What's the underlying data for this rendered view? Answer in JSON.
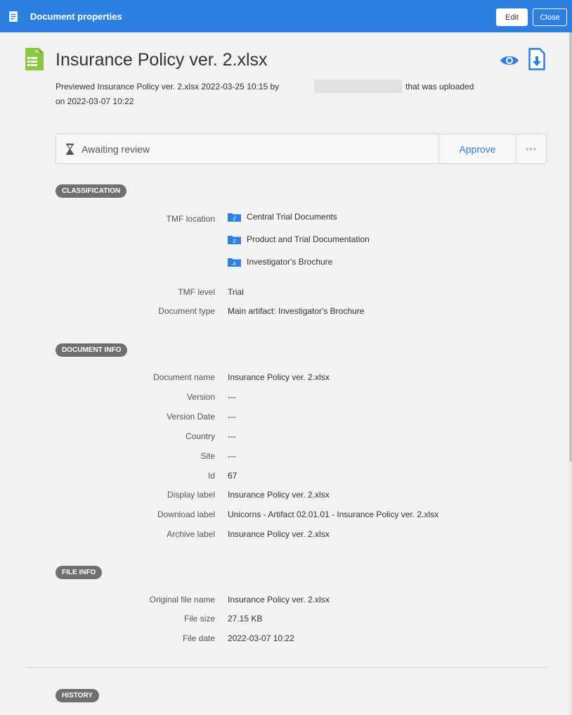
{
  "titlebar": {
    "title": "Document properties",
    "edit_label": "Edit",
    "close_label": "Close"
  },
  "document": {
    "title": "Insurance Policy ver. 2.xlsx",
    "file_icon_text": "xls",
    "desc_line1_a": "Previewed Insurance Policy ver. 2.xlsx 2022-03-25 10:15 by",
    "desc_line1_b": "that was uploaded",
    "desc_line2": "on 2022-03-07 10:22"
  },
  "status": {
    "text": "Awaiting review",
    "approve_label": "Approve",
    "more_label": "•••"
  },
  "sections": {
    "classification": "CLASSIFICATION",
    "document_info": "DOCUMENT INFO",
    "file_info": "FILE INFO",
    "history": "HISTORY"
  },
  "classification": {
    "tmf_location_label": "TMF location",
    "tmf_locations": [
      {
        "badge": "Z",
        "name": "Central Trial Documents"
      },
      {
        "badge": "S",
        "name": "Product and Trial Documentation"
      },
      {
        "badge": "A",
        "name": "Investigator's Brochure"
      }
    ],
    "tmf_level_label": "TMF level",
    "tmf_level": "Trial",
    "document_type_label": "Document type",
    "document_type": "Main artifact: Investigator's Brochure"
  },
  "document_info": {
    "rows": [
      {
        "label": "Document name",
        "value": "Insurance Policy ver. 2.xlsx"
      },
      {
        "label": "Version",
        "value": "---"
      },
      {
        "label": "Version Date",
        "value": "---"
      },
      {
        "label": "Country",
        "value": "---"
      },
      {
        "label": "Site",
        "value": "---"
      },
      {
        "label": "Id",
        "value": "67"
      },
      {
        "label": "Display label",
        "value": "Insurance Policy ver. 2.xlsx"
      },
      {
        "label": "Download label",
        "value": "Unicorns -  Artifact 02.01.01 - Insurance Policy ver. 2.xlsx"
      },
      {
        "label": "Archive label",
        "value": "Insurance Policy ver. 2.xlsx"
      }
    ]
  },
  "file_info": {
    "rows": [
      {
        "label": "Original file name",
        "value": "Insurance Policy ver. 2.xlsx"
      },
      {
        "label": "File size",
        "value": "27.15 KB"
      },
      {
        "label": "File date",
        "value": "2022-03-07 10:22"
      }
    ]
  },
  "colors": {
    "accent": "#2d7fe0",
    "pill": "#6f6f6f",
    "xls_green": "#8dc63f",
    "background": "#f2f2f2"
  },
  "icons": {
    "titlebar": "document-icon",
    "file": "spreadsheet-file-icon",
    "preview": "eye-icon",
    "download": "download-file-icon",
    "status": "hourglass-icon",
    "folder": "folder-icon"
  }
}
